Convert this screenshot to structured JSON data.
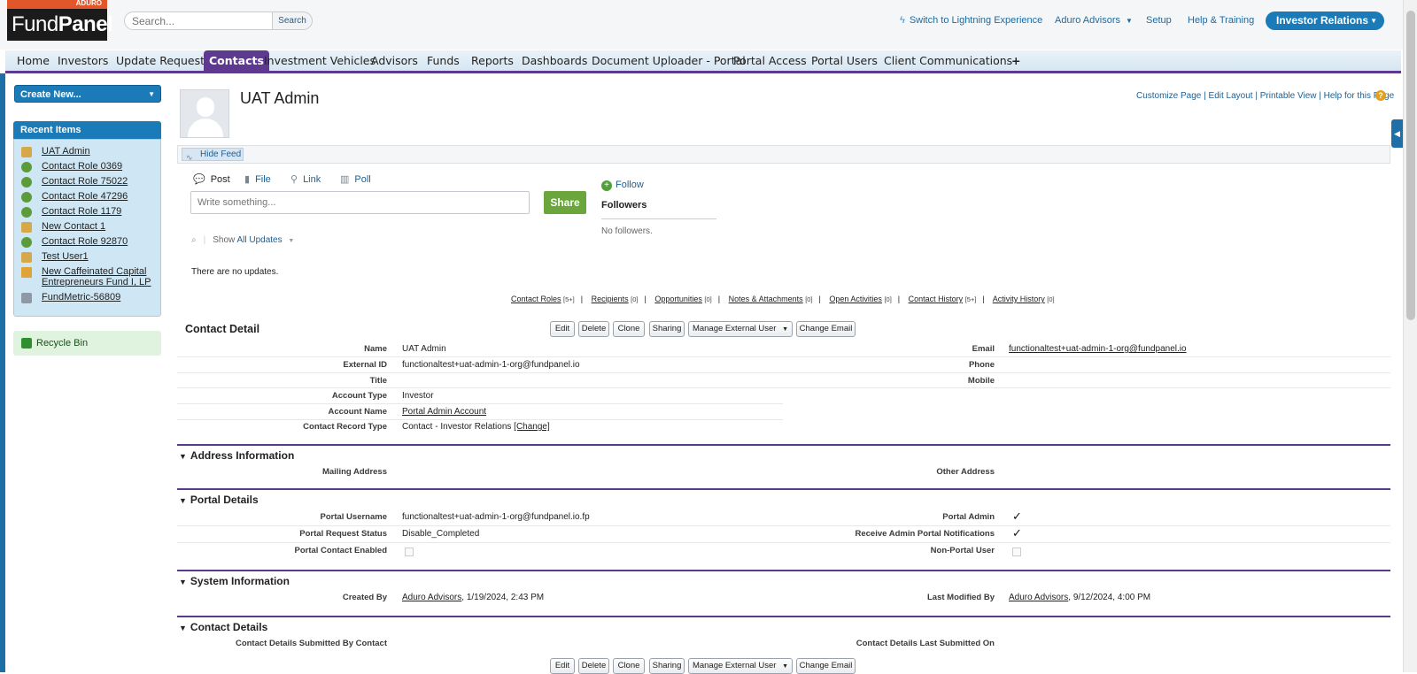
{
  "header": {
    "logo_small": "ADURO",
    "logo_name_1": "Fund",
    "logo_name_2": "Panel",
    "search_placeholder": "Search...",
    "search_button": "Search",
    "lightning_link": "Switch to Lightning Experience",
    "user_menu": "Aduro Advisors",
    "setup": "Setup",
    "help": "Help & Training",
    "app_switcher": "Investor Relations"
  },
  "tabs": [
    "Home",
    "Investors",
    "Update Requests",
    "Contacts",
    "Investment Vehicles",
    "Advisors",
    "Funds",
    "Reports",
    "Dashboards",
    "Document Uploader - Portal",
    "Portal Access",
    "Portal Users",
    "Client Communications",
    "+"
  ],
  "sidebar": {
    "create_new": "Create New...",
    "recent_title": "Recent Items",
    "recent_items": [
      {
        "label": "UAT Admin",
        "icon": "contact-icon",
        "color": "#d7a84a"
      },
      {
        "label": "Contact Role 0369",
        "icon": "gear-icon",
        "color": "#5b9b3a"
      },
      {
        "label": "Contact Role 75022",
        "icon": "gear-icon",
        "color": "#5b9b3a"
      },
      {
        "label": "Contact Role 47296",
        "icon": "gear-icon",
        "color": "#5b9b3a"
      },
      {
        "label": "Contact Role 1179",
        "icon": "gear-icon",
        "color": "#5b9b3a"
      },
      {
        "label": "New Contact 1",
        "icon": "contact-icon",
        "color": "#d7a84a"
      },
      {
        "label": "Contact Role 92870",
        "icon": "gear-icon",
        "color": "#5b9b3a"
      },
      {
        "label": "Test User1",
        "icon": "contact-icon",
        "color": "#d7a84a"
      },
      {
        "label": "New Caffeinated Capital Entrepreneurs Fund I, LP",
        "icon": "box-icon",
        "color": "#e0a33a"
      },
      {
        "label": "FundMetric-56809",
        "icon": "metric-icon",
        "color": "#8d9aa5"
      }
    ],
    "recycle_bin": "Recycle Bin"
  },
  "record": {
    "title": "UAT Admin",
    "page_links": [
      "Customize Page",
      "Edit Layout",
      "Printable View",
      "Help for this Page"
    ],
    "hide_feed": "Hide Feed"
  },
  "feed": {
    "post": "Post",
    "file": "File",
    "link": "Link",
    "poll": "Poll",
    "input_placeholder": "Write something...",
    "share": "Share",
    "follow": "Follow",
    "followers": "Followers",
    "no_followers": "No followers.",
    "show_label": "Show",
    "show_value": "All Updates",
    "no_updates": "There are no updates."
  },
  "related_links": [
    {
      "label": "Contact Roles",
      "count": "[5+]"
    },
    {
      "label": "Recipients",
      "count": "[0]"
    },
    {
      "label": "Opportunities",
      "count": "[0]"
    },
    {
      "label": "Notes & Attachments",
      "count": "[0]"
    },
    {
      "label": "Open Activities",
      "count": "[0]"
    },
    {
      "label": "Contact History",
      "count": "[5+]"
    },
    {
      "label": "Activity History",
      "count": "[0]"
    }
  ],
  "detail": {
    "title": "Contact Detail",
    "buttons": [
      "Edit",
      "Delete",
      "Clone",
      "Sharing",
      "Manage External User",
      "Change Email"
    ],
    "labels": {
      "name": "Name",
      "external_id": "External ID",
      "title": "Title",
      "account_type": "Account Type",
      "account_name": "Account Name",
      "record_type": "Contact Record Type",
      "email": "Email",
      "phone": "Phone",
      "mobile": "Mobile"
    },
    "values": {
      "name": "UAT Admin",
      "external_id": "functionaltest+uat-admin-1-org@fundpanel.io",
      "account_type": "Investor",
      "account_name": "Portal Admin Account",
      "record_type": "Contact - Investor Relations",
      "record_type_change": "[Change]",
      "email": "functionaltest+uat-admin-1-org@fundpanel.io"
    }
  },
  "address": {
    "title": "Address Information",
    "mailing": "Mailing Address",
    "other": "Other Address"
  },
  "portal": {
    "title": "Portal Details",
    "username_label": "Portal Username",
    "username_value": "functionaltest+uat-admin-1-org@fundpanel.io.fp",
    "status_label": "Portal Request Status",
    "status_value": "Disable_Completed",
    "enabled_label": "Portal Contact Enabled",
    "admin_label": "Portal Admin",
    "notif_label": "Receive Admin Portal Notifications",
    "nonportal_label": "Non-Portal User",
    "check": "✓"
  },
  "system": {
    "title": "System Information",
    "created_label": "Created By",
    "created_user": "Aduro Advisors",
    "created_date": ", 1/19/2024, 2:43 PM",
    "modified_label": "Last Modified By",
    "modified_user": "Aduro Advisors",
    "modified_date": ", 9/12/2024, 4:00 PM"
  },
  "contact_details": {
    "title": "Contact Details",
    "submitted_by": "Contact Details Submitted By Contact",
    "submitted_on": "Contact Details Last Submitted On"
  }
}
